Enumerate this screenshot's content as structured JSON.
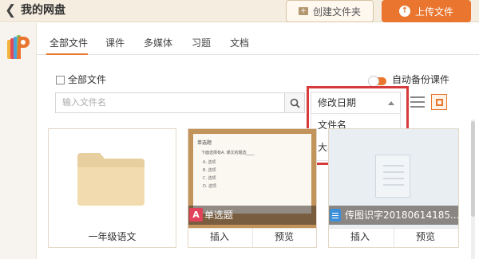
{
  "header": {
    "back_icon": "chevron-left-icon",
    "title": "我的网盘",
    "create_folder_label": "创建文件夹",
    "upload_label": "上传文件"
  },
  "tabs": [
    {
      "label": "全部文件",
      "active": true
    },
    {
      "label": "课件"
    },
    {
      "label": "多媒体"
    },
    {
      "label": "习题"
    },
    {
      "label": "文档"
    }
  ],
  "toolbar": {
    "select_all_label": "全部文件",
    "auto_backup_label": "自动备份课件",
    "auto_backup_on": true,
    "search_placeholder": "输入文件名"
  },
  "sort": {
    "selected": "修改日期",
    "options": [
      "文件名",
      "大小"
    ]
  },
  "files": [
    {
      "name": "一年级语文",
      "type": "folder"
    },
    {
      "name": "单选题",
      "type": "exercise",
      "badge": "A",
      "actions": [
        "插入",
        "预览"
      ],
      "preview": {
        "title": "单选题",
        "question": "下面选择有A. 课文的题选____",
        "options": [
          "A. 选项",
          "B. 选项",
          "C. 选项",
          "D. 选项"
        ]
      }
    },
    {
      "name": "传图识字20180614185...",
      "type": "document",
      "actions": [
        "插入",
        "预览"
      ]
    }
  ],
  "colors": {
    "accent": "#e9752f",
    "highlight": "#d63a3a"
  }
}
